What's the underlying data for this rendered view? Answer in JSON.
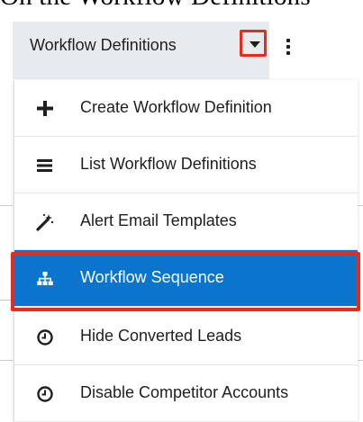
{
  "page_heading": "On the Workflow Definitions",
  "nav": {
    "module_label": "Workflow Definitions",
    "dropdown_icon": "caret-down-icon",
    "more_icon": "kebab-vertical-icon"
  },
  "menu": {
    "items": [
      {
        "label": "Create Workflow Definition",
        "icon": "plus-icon"
      },
      {
        "label": "List Workflow Definitions",
        "icon": "list-icon"
      },
      {
        "label": "Alert Email Templates",
        "icon": "magic-wand-icon"
      },
      {
        "label": "Workflow Sequence",
        "icon": "sitemap-icon",
        "active": true
      },
      {
        "label": "Hide Converted Leads",
        "icon": "clock-icon"
      },
      {
        "label": "Disable Competitor Accounts",
        "icon": "clock-icon"
      }
    ]
  },
  "colors": {
    "active_bg": "#0b75ce",
    "highlight_border": "#e8291c",
    "nav_bg": "#e8ebee"
  }
}
